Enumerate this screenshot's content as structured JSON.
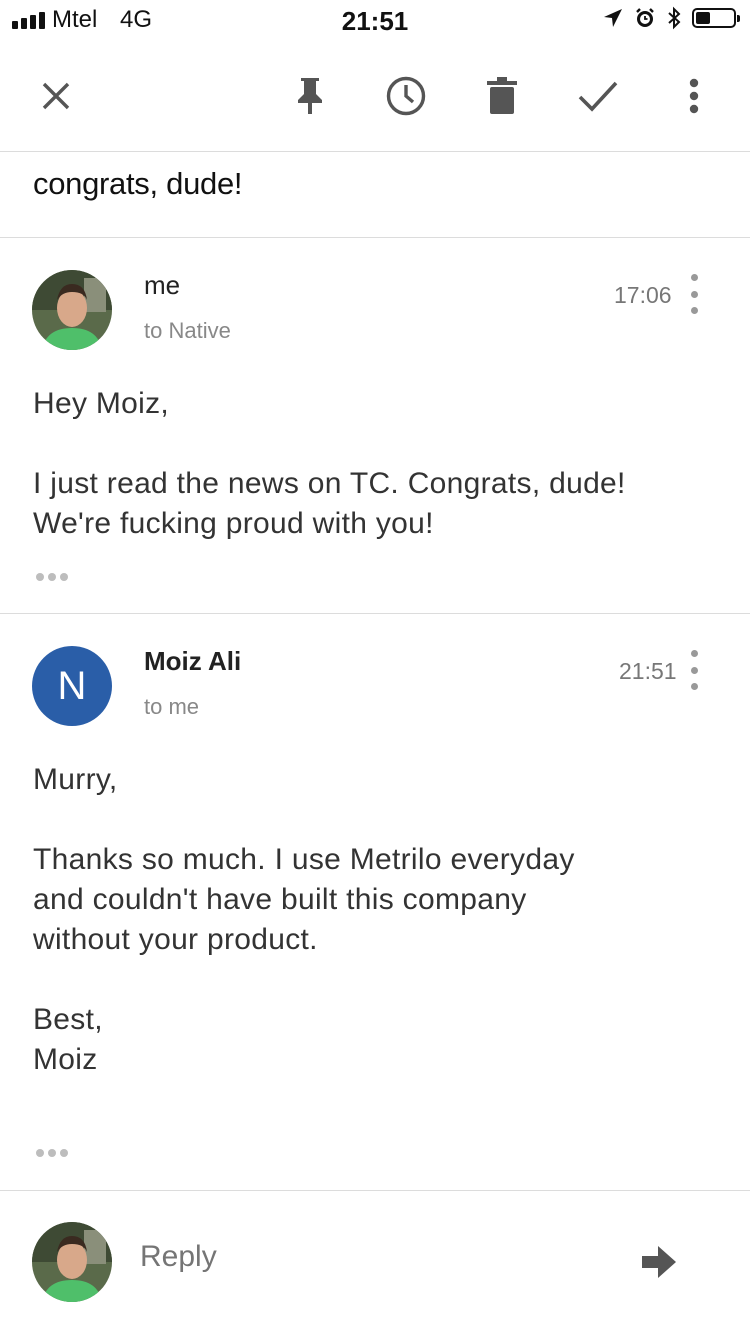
{
  "status_bar": {
    "carrier": "Mtel",
    "network": "4G",
    "time": "21:51",
    "icons": [
      "location-arrow-icon",
      "alarm-icon",
      "bluetooth-icon",
      "battery-icon"
    ]
  },
  "toolbar": {
    "actions": [
      "close-icon",
      "pin-icon",
      "snooze-clock-icon",
      "trash-icon",
      "done-check-icon",
      "more-vertical-icon"
    ]
  },
  "thread": {
    "subject": "congrats, dude!",
    "messages": [
      {
        "sender": "me",
        "recipient": "to Native",
        "time": "17:06",
        "body": "Hey Moiz,\n\nI just read the news on TC. Congrats, dude!\nWe're fucking proud with you!"
      },
      {
        "sender": "Moiz Ali",
        "avatar_letter": "N",
        "avatar_color": "#2a5ea8",
        "recipient": "to me",
        "time": "21:51",
        "body": "Murry,\n\nThanks so much.  I use Metrilo everyday\nand couldn't have built this company\nwithout your product.\n\nBest,\nMoiz"
      }
    ]
  },
  "reply": {
    "placeholder": "Reply"
  }
}
